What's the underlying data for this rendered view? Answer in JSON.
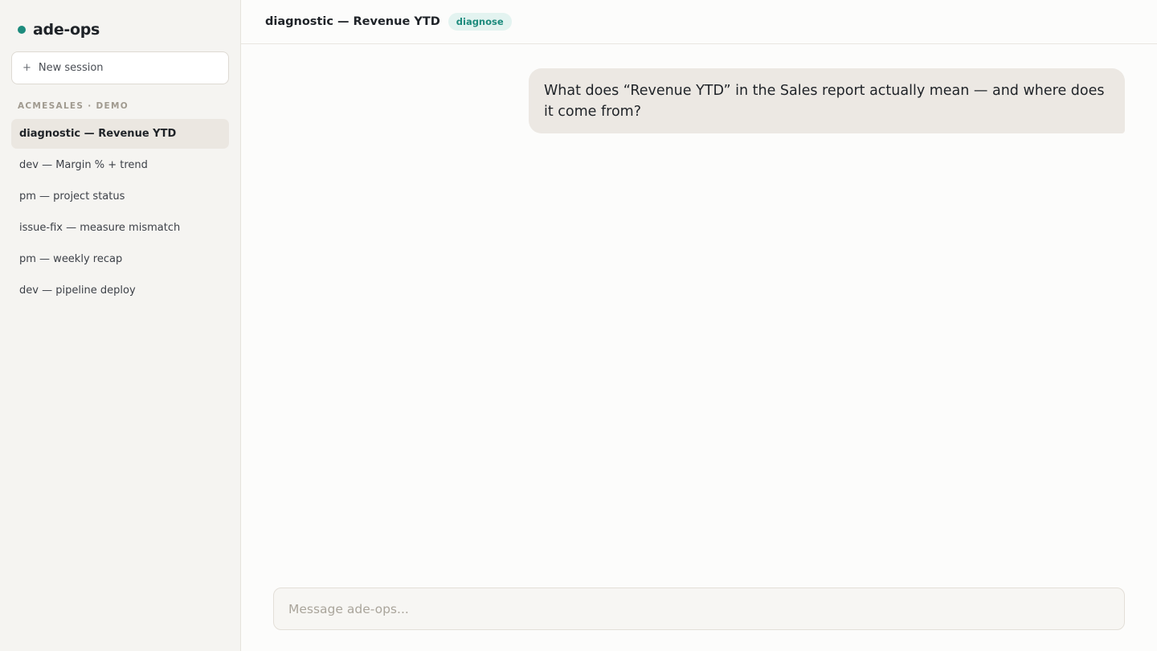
{
  "app": {
    "brand_name": "ade-ops",
    "brand_color": "#1d8b7d"
  },
  "sidebar": {
    "new_session_icon": "+",
    "new_session_label": "New session",
    "section_label": "ACMESALES · DEMO",
    "items": [
      {
        "label": "diagnostic — Revenue YTD",
        "active": true
      },
      {
        "label": "dev — Margin % + trend",
        "active": false
      },
      {
        "label": "pm — project status",
        "active": false
      },
      {
        "label": "issue-fix — measure mismatch",
        "active": false
      },
      {
        "label": "pm — weekly recap",
        "active": false
      },
      {
        "label": "dev — pipeline deploy",
        "active": false
      }
    ]
  },
  "header": {
    "title": "diagnostic — Revenue YTD",
    "mode_badge": "diagnose"
  },
  "conversation": {
    "messages": [
      {
        "role": "user",
        "text": "What does “Revenue YTD” in the Sales report actually mean — and where does it come from?"
      }
    ]
  },
  "composer": {
    "placeholder": "Message ade-ops...",
    "value": ""
  }
}
